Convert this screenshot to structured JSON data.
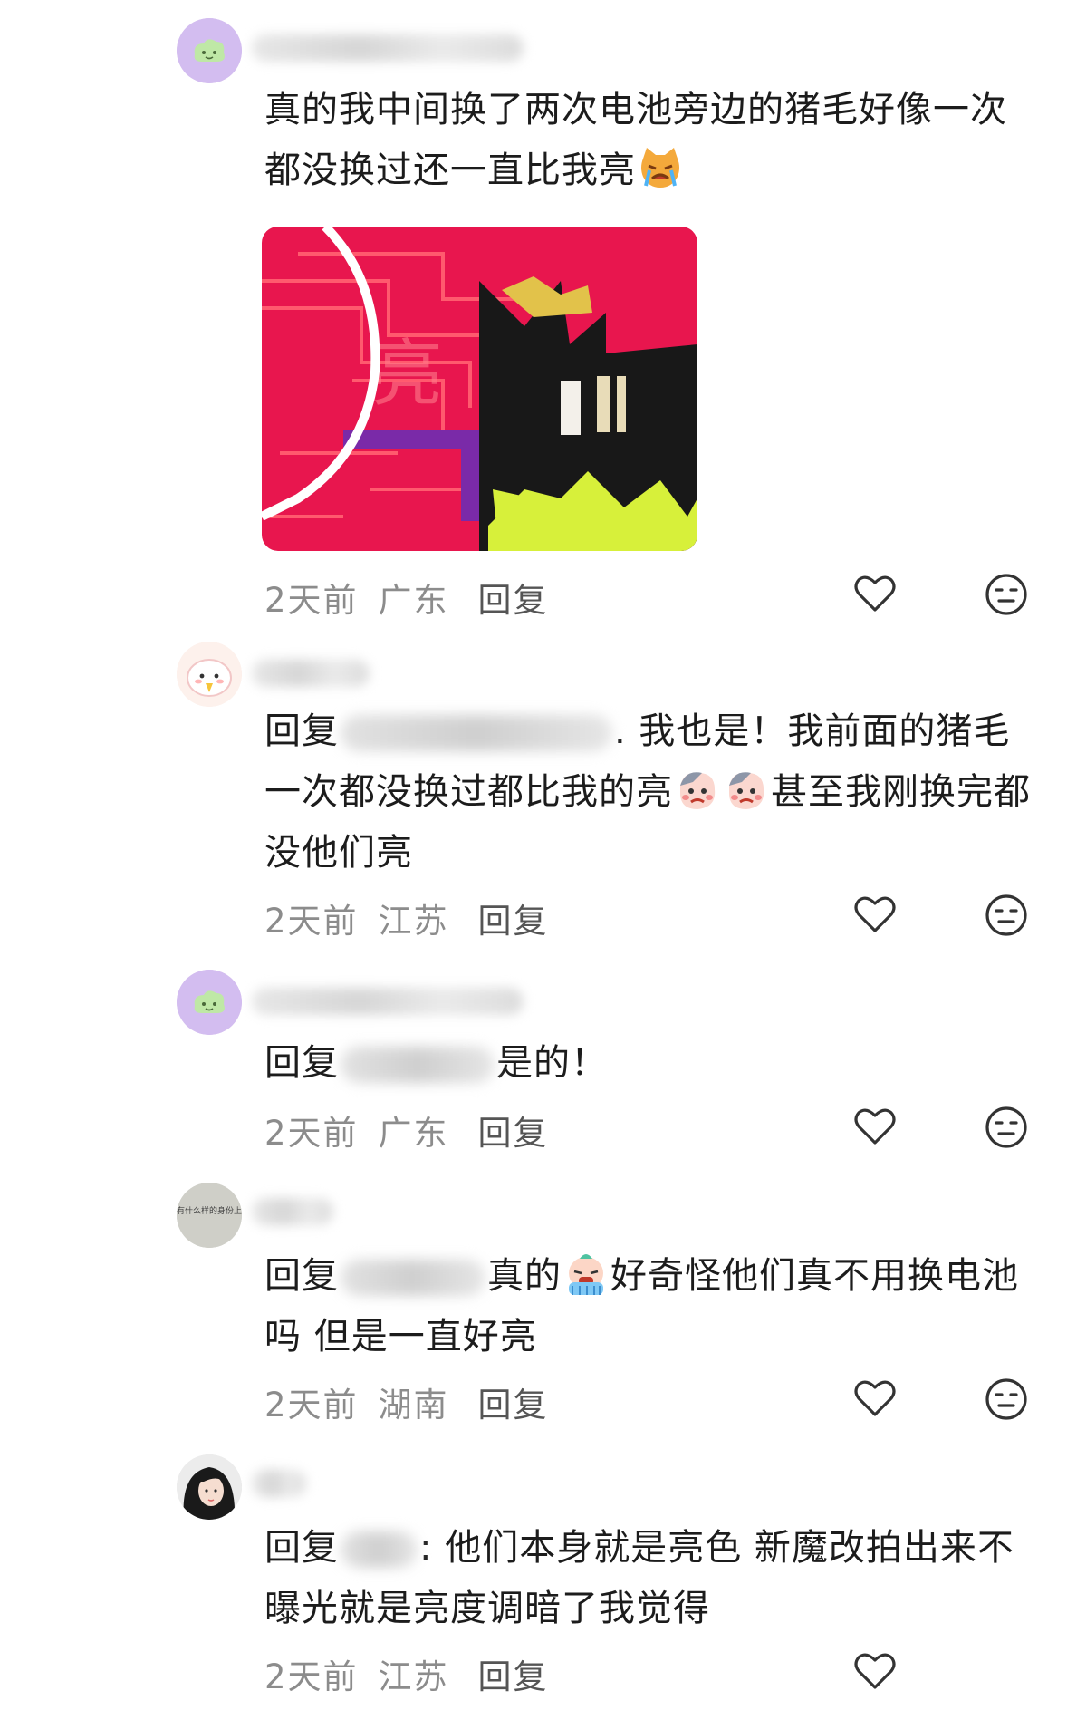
{
  "comments": [
    {
      "text": "真的我中间换了两次电池旁边的猪毛好像一次都没换过还一直比我亮",
      "time": "2天前",
      "location": "广东",
      "reply_label": "回复",
      "emoji": "crying-cat-emoji"
    },
    {
      "reply_prefix": "回复",
      "text_a": ". 我也是！我前面的猪毛一次都没换过都比我的亮",
      "text_b": "甚至我刚换完都没他们亮",
      "time": "2天前",
      "location": "江苏",
      "reply_label": "回复"
    },
    {
      "reply_prefix": "回复",
      "text": "是的！",
      "time": "2天前",
      "location": "广东",
      "reply_label": "回复"
    },
    {
      "reply_prefix": "回复",
      "text_a": "真的",
      "text_b": "好奇怪他们真不用换电池吗 但是一直好亮",
      "time": "2天前",
      "location": "湖南",
      "reply_label": "回复",
      "avatar_text": "拥有什么样的身份上岸"
    },
    {
      "reply_prefix": "回复",
      "text": ": 他们本身就是亮色 新魔改拍出来不曝光就是亮度调暗了我觉得",
      "time": "2天前",
      "location": "江苏",
      "reply_label": "回复"
    }
  ],
  "photo_visible_text": "亮",
  "colors": {
    "text": "#1c1c1c",
    "meta": "#8c8c8c",
    "photo_bg": "#e8164e",
    "photo_accent": "#d7f03a"
  }
}
